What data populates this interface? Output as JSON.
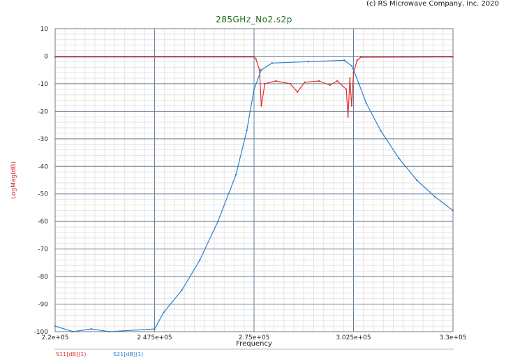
{
  "copyright": "(c) RS Microwave Company, Inc. 2020",
  "chart_data": {
    "type": "line",
    "title": "285GHz_No2.s2p",
    "xlabel": "Frequency",
    "ylabel": "LogMag(dB)",
    "xlim": [
      220000,
      330000
    ],
    "ylim": [
      -100,
      10
    ],
    "grid": true,
    "y_ticks": [
      "10",
      "0",
      "-10",
      "-20",
      "-30",
      "-40",
      "-50",
      "-60",
      "-70",
      "-80",
      "-90",
      "-100"
    ],
    "x_ticks": [
      {
        "value": 220000,
        "label": "2.2e+05"
      },
      {
        "value": 247500,
        "label": "2.475e+05"
      },
      {
        "value": 275000,
        "label": "2.75e+05"
      },
      {
        "value": 302500,
        "label": "3.025e+05"
      },
      {
        "value": 330000,
        "label": "3.3e+05"
      }
    ],
    "series": [
      {
        "name": "S11[dB](1)",
        "color": "#e03030",
        "x": [
          220000,
          275000,
          275500,
          276500,
          277000,
          278000,
          281000,
          285000,
          287000,
          289000,
          293000,
          296000,
          298000,
          300500,
          301000,
          301500,
          302000,
          302500,
          303500,
          304500,
          330000
        ],
        "y": [
          -0.3,
          -0.3,
          -1.0,
          -5.0,
          -18.0,
          -10.0,
          -9.0,
          -10.0,
          -13.0,
          -9.5,
          -9.0,
          -10.5,
          -9.0,
          -12.0,
          -22.0,
          -8.0,
          -18.0,
          -6.0,
          -1.5,
          -0.4,
          -0.3
        ]
      },
      {
        "name": "S21[dB](1)",
        "color": "#2a7fd4",
        "x": [
          220000,
          225000,
          230000,
          235000,
          247500,
          250000,
          255000,
          260000,
          265000,
          270000,
          273000,
          275000,
          277000,
          280000,
          290000,
          300000,
          302000,
          304000,
          306000,
          310000,
          315000,
          320000,
          325000,
          330000
        ],
        "y": [
          -98,
          -100,
          -99,
          -100,
          -99,
          -93,
          -85,
          -74,
          -60,
          -43,
          -27,
          -12,
          -5,
          -2.5,
          -2.0,
          -1.5,
          -3.5,
          -10,
          -17,
          -27,
          -37,
          -45,
          -51,
          -56
        ]
      }
    ]
  }
}
